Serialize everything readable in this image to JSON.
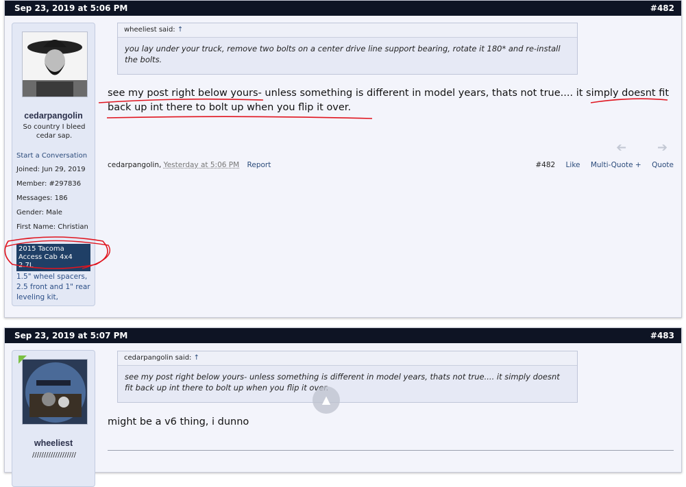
{
  "posts": [
    {
      "date": "Sep 23, 2019 at 5:06 PM",
      "number": "#482",
      "user": {
        "name": "cedarpangolin",
        "title": "So country I bleed cedar sap.",
        "start_conversation": "Start a Conversation",
        "joined": "Joined:  Jun 29, 2019",
        "member": "Member:  #297836",
        "messages": "Messages:  186",
        "gender": "Gender:  Male",
        "first_name": "First Name: Christian",
        "vehicle": "2015 Tacoma Access Cab 4x4 2.7L",
        "signature": "1.5\" wheel spacers, 2.5 front and 1\" rear leveling kit,"
      },
      "quote": {
        "author": "wheeliest said:",
        "arrow": "↑",
        "text": "you lay under your truck, remove two bolts on a center drive line support bearing, rotate it 180* and re-install the bolts."
      },
      "message": "see my post right below yours- unless something is different in model years, thats not true.... it simply doesnt fit back up int there to bolt up when you flip it over.",
      "footer": {
        "author": "cedarpangolin,",
        "time": "Yesterday at 5:06 PM",
        "report": "Report",
        "number": "#482",
        "like": "Like",
        "multiquote": "Multi-Quote +",
        "quote": "Quote"
      }
    },
    {
      "date": "Sep 23, 2019 at 5:07 PM",
      "number": "#483",
      "user": {
        "name": "wheeliest",
        "title": "///////////////////"
      },
      "quote": {
        "author": "cedarpangolin said:",
        "arrow": "↑",
        "text": "see my post right below yours- unless something is different in model years, thats not true.... it simply doesnt fit back up int there to bolt up when you flip it over."
      },
      "message": "might be a v6 thing, i dunno"
    }
  ],
  "icons": {
    "prev": "prev-arrow-icon",
    "next": "next-arrow-icon",
    "scroll_top": "chevron-up-icon"
  },
  "colors": {
    "header_bg": "#0e1424",
    "annotation_red": "#e0141e",
    "vehicle_banner": "#1f3f66"
  }
}
